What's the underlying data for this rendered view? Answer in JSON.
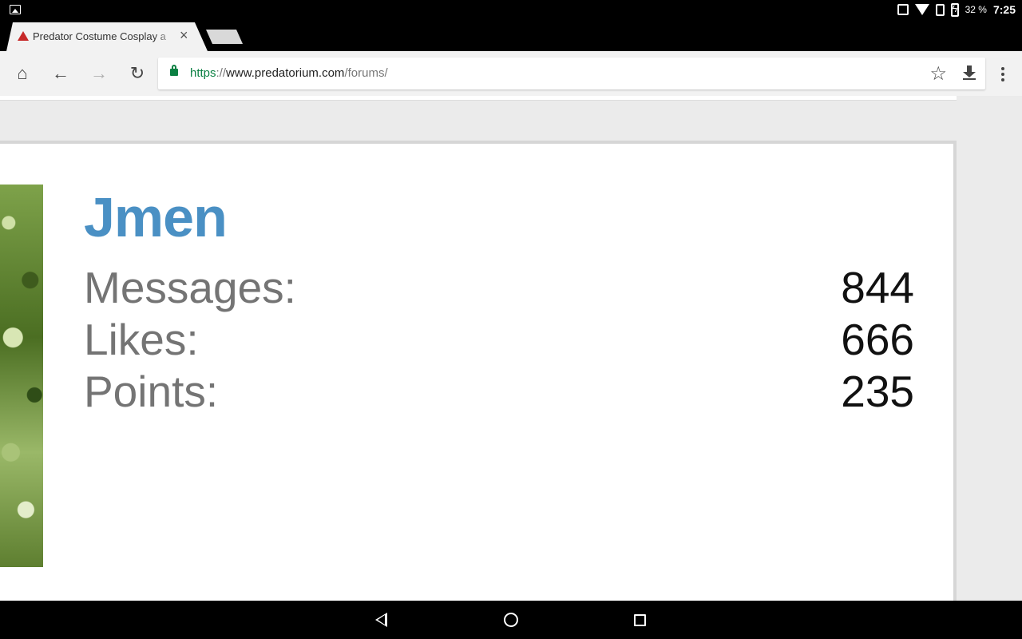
{
  "status_bar": {
    "battery_percent": "32 %",
    "time": "7:25"
  },
  "tabs": [
    {
      "title": "Predator Costume Cosplay a",
      "active": true
    }
  ],
  "omnibox": {
    "scheme": "https",
    "separator": "://",
    "host": "www.predatorium.com",
    "path": "/forums/"
  },
  "colors": {
    "username": "#4a90c4",
    "secure": "#0b8043",
    "favicon": "#c62828"
  },
  "profile": {
    "username": "Jmen",
    "stats": [
      {
        "label": "Messages:",
        "value": "844"
      },
      {
        "label": "Likes:",
        "value": "666"
      },
      {
        "label": "Points:",
        "value": "235"
      }
    ]
  }
}
